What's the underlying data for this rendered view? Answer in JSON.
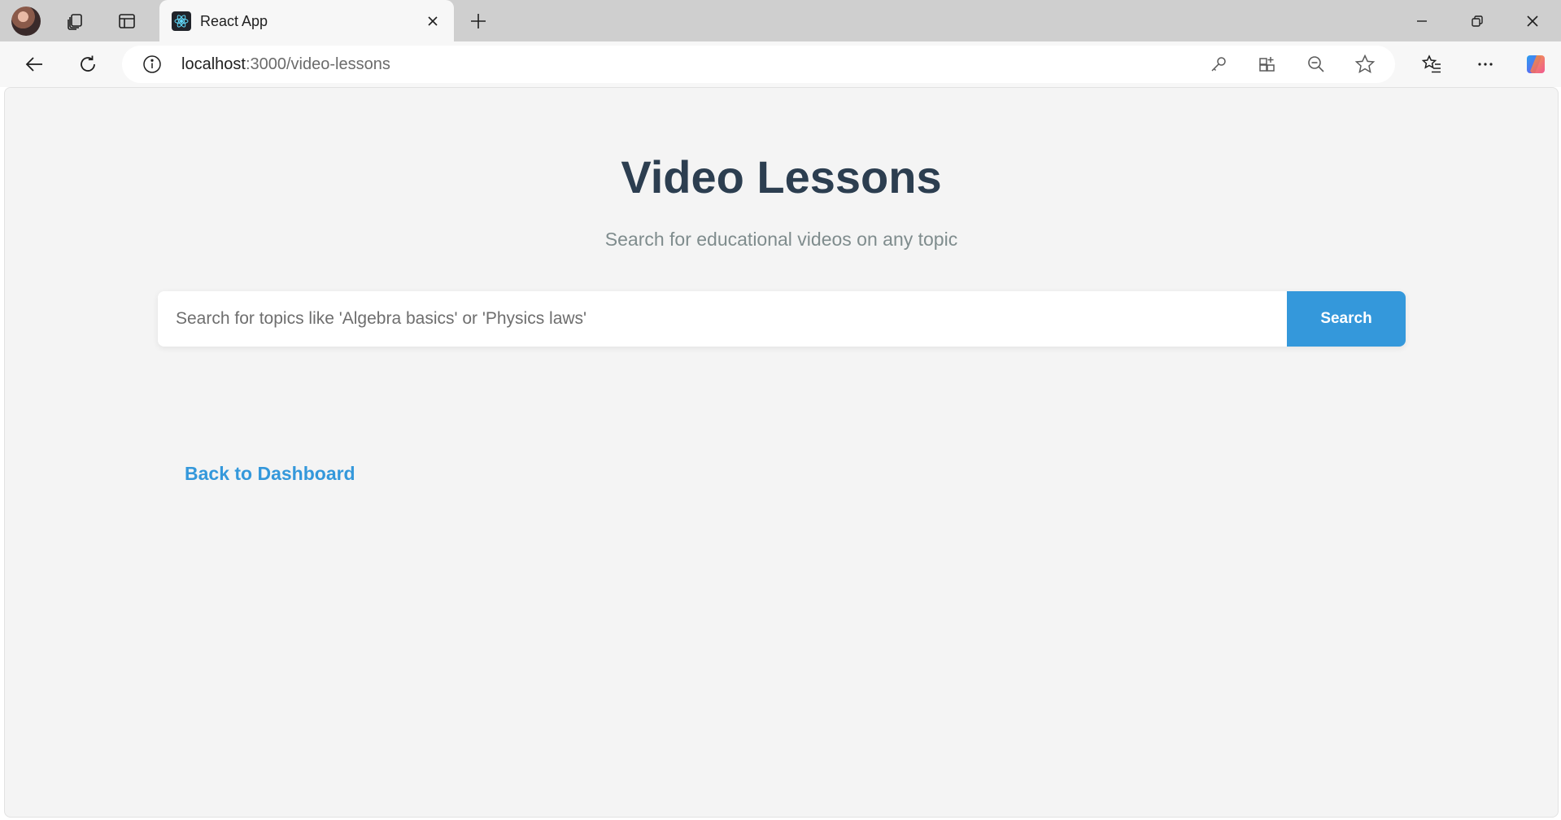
{
  "browser": {
    "tab": {
      "title": "React App"
    },
    "address_bar": {
      "host": "localhost",
      "path": ":3000/video-lessons"
    }
  },
  "page": {
    "title": "Video Lessons",
    "subtitle": "Search for educational videos on any topic",
    "search": {
      "placeholder": "Search for topics like 'Algebra basics' or 'Physics laws'",
      "value": "",
      "button_label": "Search"
    },
    "back_link": "Back to Dashboard"
  },
  "colors": {
    "accent": "#3498db",
    "title": "#2c3e50",
    "subtitle": "#7f8c8d",
    "page_bg": "#f4f4f4"
  }
}
